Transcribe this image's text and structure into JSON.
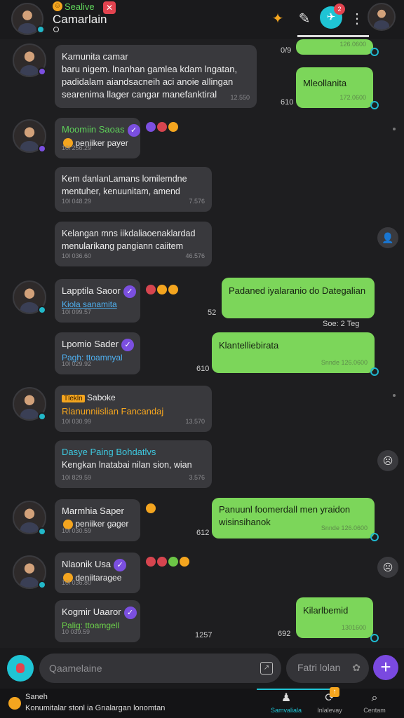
{
  "header": {
    "subtitle": "Sealive",
    "title": "Camarlain",
    "badge_count": "2"
  },
  "messages": {
    "m1": {
      "text": "Kamunita camar\nbaru nigem. lnanhan gamlea kdam lngatan, padidalam aiandsacneih aci anoie allingan searenima llager cangar manefanktiral",
      "time": "12.550"
    },
    "o1": {
      "text": "",
      "time": "126.0600",
      "side": "0/9"
    },
    "o2": {
      "text": "Mleollanita",
      "time": "172.0600",
      "side": "610"
    },
    "s1": {
      "name": "Moomiin Saoas",
      "sub": "peniiker payer",
      "time": "10l 256.29"
    },
    "m2": {
      "text": "Kem danlanLamans lomilemdne\nmentuher, kenuunitam, amend",
      "time_l": "10l 048.29",
      "time_r": "7.576"
    },
    "m3": {
      "text": "Kelangan mns iikdaliaoenaklardad\nmenularikang pangiann caiitem",
      "time_l": "10l 036.60",
      "time_r": "46.576"
    },
    "s2": {
      "name": "Lapptila Saoor",
      "sub": "Kiola sanamita",
      "time": "10l 099.57"
    },
    "o3": {
      "text": "Padaned iyalaranio do Dategalian",
      "side": "52",
      "foot": "Soe: 2 Teg"
    },
    "s3": {
      "name": "Lpomio Sader",
      "sub": "Pagh: ttoamnyal",
      "time": "10l 029.92"
    },
    "o4": {
      "text": "Klantelliebirata",
      "time": "Snnde 126.0600",
      "side": "610"
    },
    "s4": {
      "tag": "Tlekln",
      "name": "Saboke",
      "sub": "Rlanunniislian Fancandaj",
      "time": "10l 030.99",
      "time_r": "13.570"
    },
    "m4": {
      "title": "Dasye Paing Bohdatlvs",
      "text": "Kengkan lnatabai nilan sion, wian",
      "time_l": "10l 829.59",
      "time_r": "3.576"
    },
    "s5": {
      "name": "Marmhia Saper",
      "sub": "peniiker gager",
      "time": "10l 030.59",
      "side": "612"
    },
    "o5": {
      "text": "Panuunl foomerdall men yraidon\nwisinsihanok",
      "time": "Snnde 126.0600"
    },
    "s6": {
      "name": "Nlaonik Usa",
      "sub": "deniitaragee",
      "time": "10l 036.80"
    },
    "s7": {
      "name": "Kogmir Uaaror",
      "sub": "Palig: ttoamgell",
      "time": "10 039.59",
      "time_r": "1257"
    },
    "o6": {
      "text": "Kilarlbemid",
      "time": "1301600",
      "side": "692"
    }
  },
  "composer": {
    "placeholder": "Qaamelaine",
    "secondary": "Fatri lolan"
  },
  "navbar": {
    "hint_title": "Saneh",
    "hint_text": "Konumitalar stonl ia Gnalargan lonomtan",
    "tab1": "Samvaliala",
    "tab2": "Inlalevay",
    "tab3": "Centam"
  },
  "colors": {
    "accent": "#1fc4d4",
    "bubble_out": "#7cd65a",
    "bubble_in": "#39393d",
    "verified": "#7b4fe0"
  }
}
